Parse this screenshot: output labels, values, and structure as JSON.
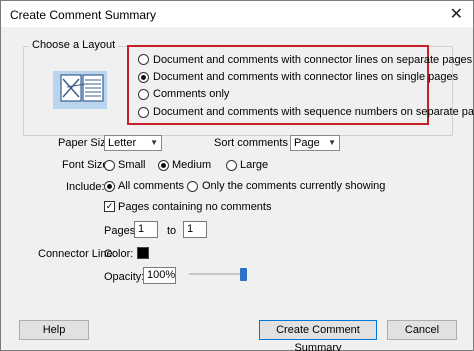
{
  "window": {
    "title": "Create Comment Summary",
    "close_glyph": "✕"
  },
  "layout_group": {
    "label": "Choose a Layout",
    "options": [
      {
        "label": "Document and comments with connector lines on separate pages",
        "selected": false
      },
      {
        "label": "Document and comments with connector lines on single pages",
        "selected": true
      },
      {
        "label": "Comments only",
        "selected": false
      },
      {
        "label": "Document and comments with sequence numbers on separate pages",
        "selected": false
      }
    ]
  },
  "paper_size": {
    "label": "Paper Size:",
    "value": "Letter"
  },
  "sort_by": {
    "label": "Sort comments by:",
    "value": "Page"
  },
  "font_size": {
    "label": "Font Size:",
    "options": [
      {
        "label": "Small",
        "selected": false
      },
      {
        "label": "Medium",
        "selected": true
      },
      {
        "label": "Large",
        "selected": false
      }
    ]
  },
  "include": {
    "label": "Include:",
    "options": [
      {
        "label": "All comments",
        "selected": true
      },
      {
        "label": "Only the comments currently showing",
        "selected": false
      }
    ]
  },
  "pages_no_comments": {
    "label": "Pages containing no comments",
    "checked": true
  },
  "pages": {
    "label": "Pages",
    "from": "1",
    "to_label": "to",
    "to": "1"
  },
  "connector_line": {
    "label": "Connector Line:",
    "color_label": "Color:",
    "color": "#000000"
  },
  "opacity": {
    "label": "Opacity:",
    "value": "100%",
    "level": 1.0
  },
  "buttons": {
    "help": "Help",
    "create": "Create Comment Summary",
    "cancel": "Cancel"
  },
  "colors": {
    "highlight": "#c8202a",
    "slider": "#2b70c9"
  }
}
